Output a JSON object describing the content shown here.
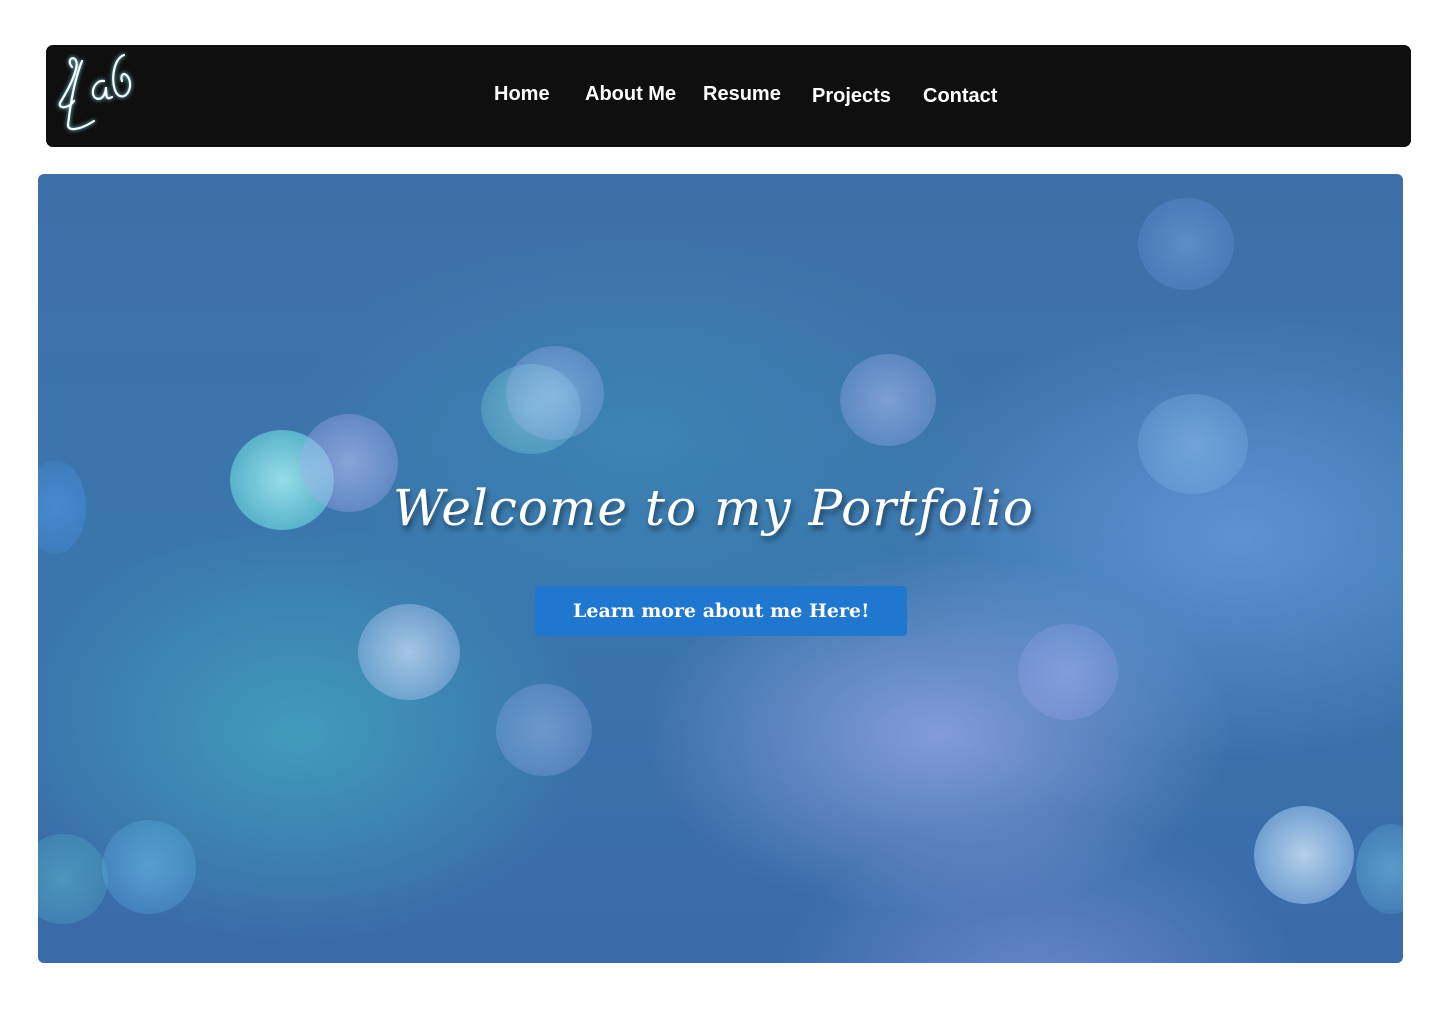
{
  "navbar": {
    "logo_name": "script-monogram-logo",
    "links": [
      {
        "label": "Home"
      },
      {
        "label": "About Me"
      },
      {
        "label": "Resume"
      },
      {
        "label": "Projects"
      },
      {
        "label": "Contact"
      }
    ]
  },
  "hero": {
    "title": "Welcome to my Portfolio",
    "button_label": "Learn more about me Here!"
  },
  "colors": {
    "navbar_background": "#0f0f0f",
    "button_background": "#1f77d0",
    "text": "#ffffff",
    "hero_base": "#3a76ad"
  }
}
